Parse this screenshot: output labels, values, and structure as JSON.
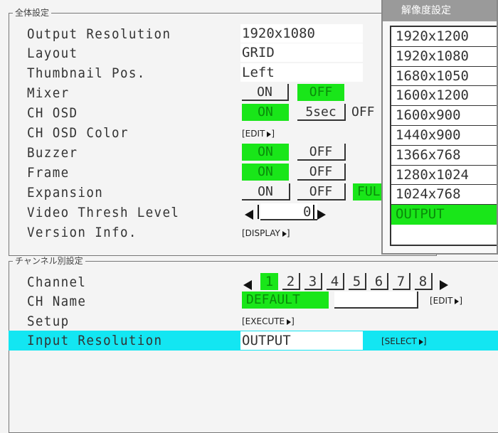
{
  "global": {
    "legend": "全体設定",
    "labels": {
      "output_resolution": "Output Resolution",
      "layout": "Layout",
      "thumbnail_pos": "Thumbnail Pos.",
      "mixer": "Mixer",
      "ch_osd": "CH OSD",
      "ch_osd_color": "CH OSD Color",
      "buzzer": "Buzzer",
      "frame": "Frame",
      "expansion": "Expansion",
      "video_thresh": "Video Thresh Level",
      "version_info": "Version Info."
    },
    "values": {
      "output_resolution": "1920x1080",
      "layout": "GRID",
      "thumbnail_pos": "Left",
      "mixer_on": "ON",
      "mixer_off": "OFF",
      "ch_osd_on": "ON",
      "ch_osd_5sec": "5sec",
      "ch_osd_off": "OFF",
      "ch_osd_color_action": "[EDIT",
      "buzzer_on": "ON",
      "buzzer_off": "OFF",
      "frame_on": "ON",
      "frame_off": "OFF",
      "expansion_on": "ON",
      "expansion_off": "OFF",
      "expansion_full": "FULL",
      "video_thresh_value": "0",
      "version_action": "[DISPLAY"
    }
  },
  "channel": {
    "legend": "チャンネル別設定",
    "labels": {
      "channel": "Channel",
      "ch_name": "CH Name",
      "setup": "Setup",
      "input_resolution": "Input Resolution"
    },
    "channels": [
      "1",
      "2",
      "3",
      "4",
      "5",
      "6",
      "7",
      "8"
    ],
    "selected_channel": "1",
    "ch_name_value": "DEFAULT",
    "ch_name_action": "[EDIT",
    "setup_action": "[EXECUTE",
    "input_resolution_value": "OUTPUT",
    "input_resolution_action": "[SELECT"
  },
  "popup": {
    "title": "解像度設定",
    "options": [
      "1920x1200",
      "1920x1080",
      "1680x1050",
      "1600x1200",
      "1600x900",
      "1440x900",
      "1366x768",
      "1280x1024",
      "1024x768",
      "OUTPUT"
    ],
    "selected": "OUTPUT"
  },
  "colors": {
    "active_green": "#19e619",
    "highlight_cyan": "#13e6f2",
    "popup_title_bg": "#9a9a9a"
  }
}
